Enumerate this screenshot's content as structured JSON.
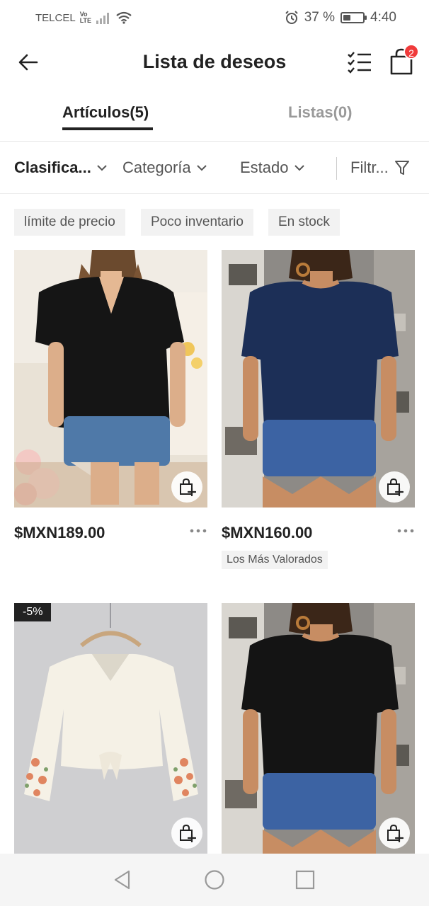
{
  "status_bar": {
    "carrier": "TELCEL",
    "network_top": "Vo",
    "network_bottom": "LTE",
    "battery_percent": "37 %",
    "battery_level": 0.37,
    "time": "4:40"
  },
  "header": {
    "title": "Lista de deseos",
    "cart_badge": "2",
    "icons": [
      "back-arrow-icon",
      "checklist-icon",
      "shopping-bag-icon"
    ]
  },
  "tabs": [
    {
      "label": "Artículos(5)",
      "active": true
    },
    {
      "label": "Listas(0)",
      "active": false
    }
  ],
  "filters": {
    "sort": "Clasifica...",
    "category": "Categoría",
    "state": "Estado",
    "filter": "Filtr..."
  },
  "chips": [
    "límite de precio",
    "Poco inventario",
    "En stock"
  ],
  "products": [
    {
      "price": "$MXN189.00",
      "tag": "",
      "discount": "",
      "image": "black-vneck-blouse-photo"
    },
    {
      "price": "$MXN160.00",
      "tag": "Los Más Valorados",
      "discount": "",
      "image": "navy-puff-sleeve-top-photo"
    },
    {
      "price": "",
      "tag": "",
      "discount": "-5%",
      "image": "white-floral-sleeve-blouse-photo"
    },
    {
      "price": "",
      "tag": "",
      "discount": "",
      "image": "black-puff-sleeve-top-photo"
    }
  ],
  "colors": {
    "text": "#222222",
    "muted": "#999999",
    "chip_bg": "#f2f2f2",
    "badge": "#f03b3b"
  }
}
